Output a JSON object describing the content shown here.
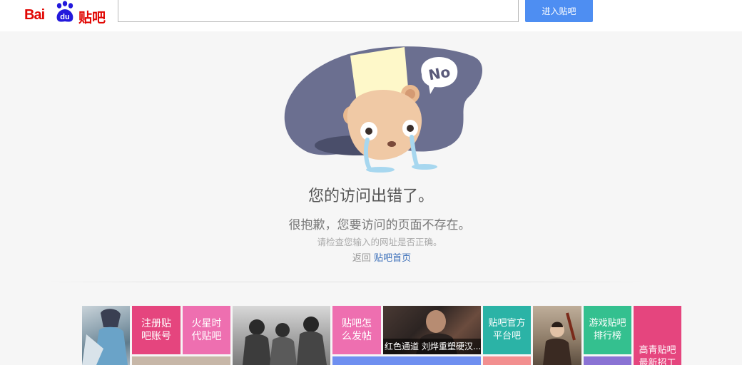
{
  "header": {
    "logo_text_latin": "Bai",
    "logo_text_du": "du",
    "logo_text_cn": "贴吧",
    "search": {
      "value": "",
      "placeholder": ""
    },
    "enter_button_label": "进入贴吧"
  },
  "error": {
    "bubble_text": "No",
    "title": "您的访问出错了。",
    "subtitle": "很抱歉，您要访问的页面不存在。",
    "hint": "请检查您输入的网址是否正确。",
    "back_prefix": "返回",
    "back_link": "贴吧首页"
  },
  "tiles": {
    "register": "注册贴吧账号",
    "mars": "火星时代贴吧",
    "how_to_post": "贴吧怎么发帖",
    "red_channel_caption": "红色通道 刘烨重塑硬汉...",
    "official": "贴吧官方平台吧",
    "games_rank": "游戏贴吧排行榜",
    "hd_latest": "高青贴吧最新招工"
  },
  "colors": {
    "brand_red": "#e10602",
    "button_blue": "#4e8ef2",
    "link_blue": "#3b6fb9",
    "tile_pink": "#e5457e",
    "tile_light_pink": "#ee6fb0",
    "tile_teal": "#2bb3a6",
    "tile_green": "#34c08f"
  }
}
